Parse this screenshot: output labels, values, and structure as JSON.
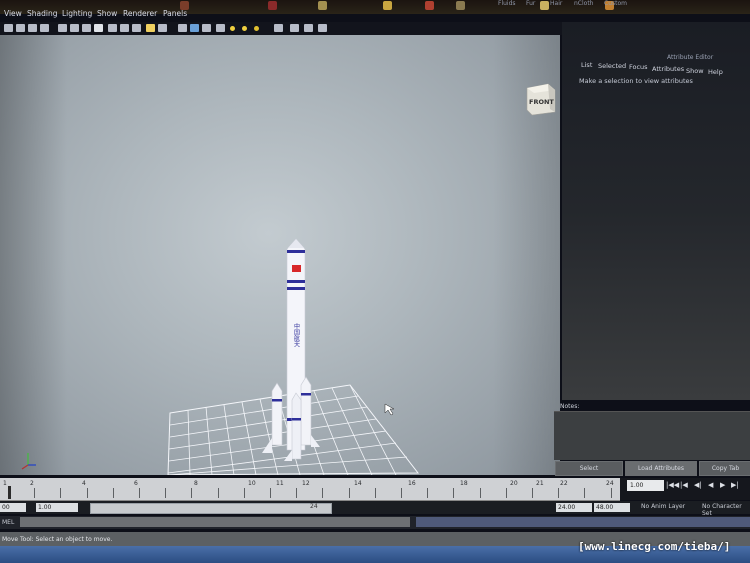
{
  "shelf": {
    "tabs": [
      "Fluids",
      "Fur",
      "Hair",
      "nCloth",
      "Custom"
    ],
    "partial_tab": "Fluids"
  },
  "menu": {
    "items": [
      "View",
      "Shading",
      "Lighting",
      "Show",
      "Renderer",
      "Panels"
    ]
  },
  "viewport": {
    "camera_label": "FRONT",
    "rocket_text": "中国航天"
  },
  "attribute_editor": {
    "title": "Attribute Editor",
    "tabs": [
      "List",
      "Selected",
      "Focus",
      "Attributes",
      "Show",
      "Help"
    ],
    "message": "Make a selection to view attributes",
    "notes_label": "Notes:",
    "buttons": [
      "Select",
      "Load Attributes",
      "Copy Tab"
    ]
  },
  "timeline": {
    "ticks": [
      "1",
      "2",
      "4",
      "6",
      "8",
      "10",
      "11",
      "12",
      "14",
      "16",
      "18",
      "20",
      "21",
      "22",
      "24"
    ],
    "current_frame": "1.00",
    "playback_buttons": [
      "|◀◀",
      "|◀",
      "◀|",
      "◀",
      "▶",
      "▶|",
      "▶▶|"
    ]
  },
  "range": {
    "start": "1.00",
    "start_inner": "1.00",
    "slider_value": "24",
    "end_inner": "24.00",
    "end": "48.00",
    "anim_layer": "No Anim Layer",
    "char_set": "No Character Set",
    "left_label": "00"
  },
  "command": {
    "label": "MEL"
  },
  "help": {
    "text": "Move Tool: Select an object to move."
  },
  "watermark": "[www.linecg.com/tieba/]"
}
